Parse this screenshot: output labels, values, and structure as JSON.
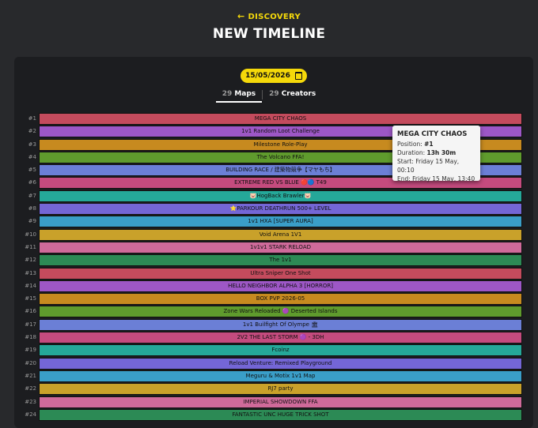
{
  "header": {
    "back_label": "DISCOVERY",
    "title": "NEW TIMELINE"
  },
  "date_picker": {
    "value": "15/05/2026"
  },
  "tabs": [
    {
      "count": "29",
      "label": "Maps",
      "active": true
    },
    {
      "count": "29",
      "label": "Creators",
      "active": false
    }
  ],
  "tooltip": {
    "title": "MEGA CITY CHAOS",
    "position_label": "Position:",
    "position_value": "#1",
    "duration_label": "Duration:",
    "duration_value": "13h 30m",
    "start": "Start: Friday 15 May, 00:10",
    "end": "End: Friday 15 May, 13:40"
  },
  "rows": [
    {
      "pos": "#1",
      "name": "MEGA CITY CHAOS",
      "color": "#c44b5d"
    },
    {
      "pos": "#2",
      "name": "1v1 Random Loot Challenge",
      "color": "#9d57c6"
    },
    {
      "pos": "#3",
      "name": "Milestone Role-Play",
      "color": "#c78a1f"
    },
    {
      "pos": "#4",
      "name": "The Volcano FFA!",
      "color": "#5f9b2d"
    },
    {
      "pos": "#5",
      "name": "BUILDING RACE / 建築物競争【マヤもち】",
      "color": "#6b7fd6"
    },
    {
      "pos": "#6",
      "name": "EXTREME RED VS BLUE 🔴🔵 T49",
      "color": "#c44b7e"
    },
    {
      "pos": "#7",
      "name": "🐷HogBack Brawler🐷",
      "color": "#25a899"
    },
    {
      "pos": "#8",
      "name": "⭐PARKOUR DEATHRUN 500+ LEVEL",
      "color": "#7466d6"
    },
    {
      "pos": "#9",
      "name": "1v1 HXA [SUPER AURA]",
      "color": "#3a9ec8"
    },
    {
      "pos": "#10",
      "name": "Void Arena 1V1",
      "color": "#c9a12a"
    },
    {
      "pos": "#11",
      "name": "1v1v1 STARK RELOAD",
      "color": "#cf6a9a"
    },
    {
      "pos": "#12",
      "name": "The 1v1",
      "color": "#2c8a55"
    },
    {
      "pos": "#13",
      "name": "Ultra Sniper One Shot",
      "color": "#c44b5d"
    },
    {
      "pos": "#14",
      "name": "HELLO NEIGHBOR ALPHA 3 [HORROR]",
      "color": "#9d57c6"
    },
    {
      "pos": "#15",
      "name": "BOX PVP 2026-05",
      "color": "#c78a1f"
    },
    {
      "pos": "#16",
      "name": "Zone Wars Reloaded 🟣 Deserted Islands",
      "color": "#5f9b2d"
    },
    {
      "pos": "#17",
      "name": "1v1 Builfight Of Olympe 🏛",
      "color": "#6b7fd6"
    },
    {
      "pos": "#18",
      "name": "2V2 THE LAST STORM 🟣 - 3DH",
      "color": "#c44b7e"
    },
    {
      "pos": "#19",
      "name": "Fcoinz",
      "color": "#25a899"
    },
    {
      "pos": "#20",
      "name": "Reload Venture: Remixed Playground",
      "color": "#7466d6"
    },
    {
      "pos": "#21",
      "name": "Meguru & Motix 1v1 Map",
      "color": "#3a9ec8"
    },
    {
      "pos": "#22",
      "name": "RJ7 party",
      "color": "#c9a12a"
    },
    {
      "pos": "#23",
      "name": "IMPERIAL SHOWDOWN FFA",
      "color": "#cf6a9a"
    },
    {
      "pos": "#24",
      "name": "FANTASTIC UNC HUGE TRICK SHOT",
      "color": "#2c8a55"
    }
  ]
}
